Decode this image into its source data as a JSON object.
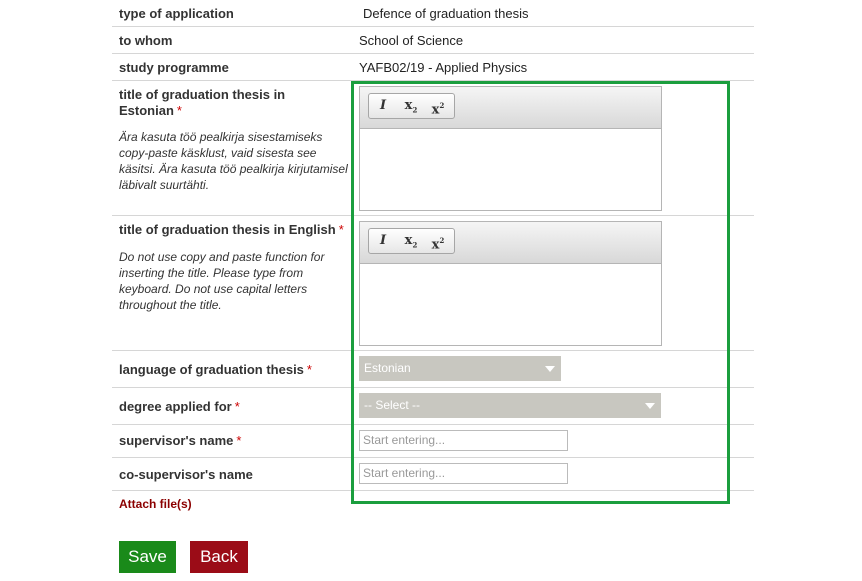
{
  "rows": {
    "type_of_application": {
      "label": "type of application",
      "value": "Defence of graduation thesis"
    },
    "to_whom": {
      "label": "to whom",
      "value": "School of Science"
    },
    "study_programme": {
      "label": "study programme",
      "value": "YAFB02/19 - Applied Physics"
    }
  },
  "title_et": {
    "label": "title of graduation thesis in Estonian",
    "required": "*",
    "hint": "Ära kasuta töö pealkirja sisestamiseks copy-paste käsklust, vaid sisesta see käsitsi. Ära kasuta töö pealkirja kirjutamisel läbivalt suurtähti."
  },
  "title_en": {
    "label": "title of graduation thesis in English",
    "required": "*",
    "hint": "Do not use copy and paste function for inserting the title. Please type from keyboard. Do not use capital letters throughout the title."
  },
  "editor_toolbar": {
    "italic": "I",
    "subscript": "x",
    "subscript_mark": "2",
    "superscript": "x",
    "superscript_mark": "2"
  },
  "language": {
    "label": "language of graduation thesis",
    "required": "*",
    "selected": "Estonian"
  },
  "degree": {
    "label": "degree applied for",
    "required": "*",
    "selected": "-- Select --"
  },
  "supervisor": {
    "label": "supervisor's name",
    "required": "*",
    "placeholder": "Start entering..."
  },
  "co_supervisor": {
    "label": "co-supervisor's name",
    "placeholder": "Start entering..."
  },
  "attach_label": "Attach file(s)",
  "buttons": {
    "save": "Save",
    "back": "Back"
  },
  "colors": {
    "highlight": "#1b9e3e",
    "save": "#1a8a1a",
    "back": "#9b0c17",
    "required": "#cc0000",
    "select_bg": "#c8c7c0"
  }
}
